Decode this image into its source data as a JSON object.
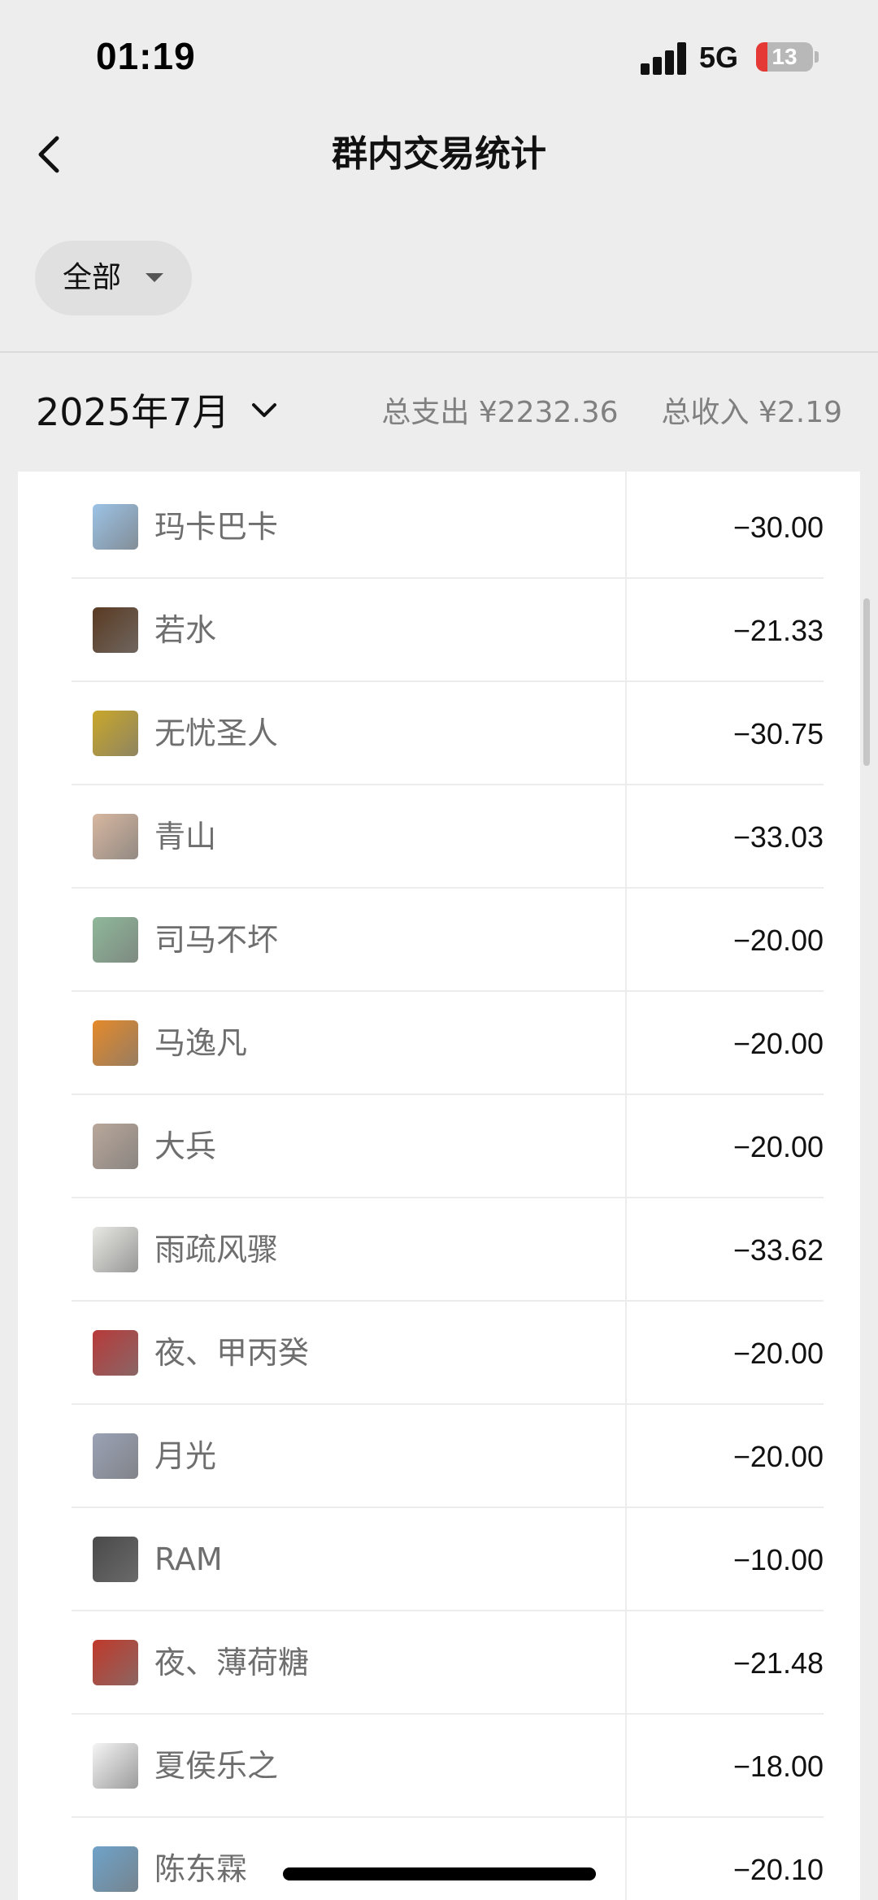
{
  "status_bar": {
    "time": "01:19",
    "network": "5G",
    "battery_level": "13"
  },
  "nav": {
    "title": "群内交易统计"
  },
  "filter": {
    "label": "全部"
  },
  "summary": {
    "month": "2025年7月",
    "total_expense_label": "总支出",
    "total_expense": "¥2232.36",
    "total_income_label": "总收入",
    "total_income": "¥2.19"
  },
  "rows": [
    {
      "name": "玛卡巴卡",
      "amount": "−30.00",
      "avatar_color": "#9cc3e6"
    },
    {
      "name": "若水",
      "amount": "−21.33",
      "avatar_color": "#5a3a22"
    },
    {
      "name": "无忧圣人",
      "amount": "−30.75",
      "avatar_color": "#c9a72a"
    },
    {
      "name": "青山",
      "amount": "−33.03",
      "avatar_color": "#d7b7a0"
    },
    {
      "name": "司马不坏",
      "amount": "−20.00",
      "avatar_color": "#8fb89a"
    },
    {
      "name": "马逸凡",
      "amount": "−20.00",
      "avatar_color": "#e58a2a"
    },
    {
      "name": "大兵",
      "amount": "−20.00",
      "avatar_color": "#b9a79a"
    },
    {
      "name": "雨疏风骤",
      "amount": "−33.62",
      "avatar_color": "#e8e8e4"
    },
    {
      "name": "夜、甲丙癸",
      "amount": "−20.00",
      "avatar_color": "#b83a3a"
    },
    {
      "name": "月光",
      "amount": "−20.00",
      "avatar_color": "#9aa2b5"
    },
    {
      "name": "RAM",
      "amount": "−10.00",
      "avatar_color": "#4a4a4a"
    },
    {
      "name": "夜、薄荷糖",
      "amount": "−21.48",
      "avatar_color": "#c0392b"
    },
    {
      "name": "夏侯乐之",
      "amount": "−18.00",
      "avatar_color": "#f5f5f5"
    },
    {
      "name": "陈东霖",
      "amount": "−20.10",
      "avatar_color": "#6fa3c9"
    }
  ]
}
